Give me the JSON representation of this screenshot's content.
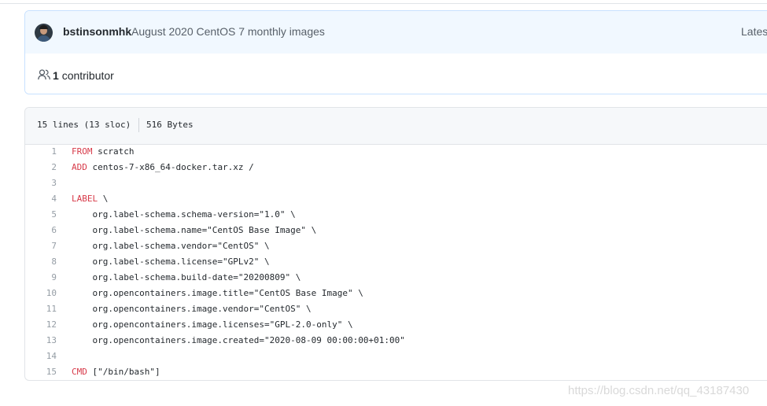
{
  "commit": {
    "author": "bstinsonmhk",
    "message": "August 2020 CentOS 7 monthly images",
    "latest_label": "Latest"
  },
  "contributors": {
    "count": "1",
    "label": "contributor"
  },
  "file": {
    "lines_info": "15 lines (13 sloc)",
    "size": "516 Bytes",
    "lines": [
      {
        "num": "1",
        "kw": "FROM",
        "rest": " scratch"
      },
      {
        "num": "2",
        "kw": "ADD",
        "rest": " centos-7-x86_64-docker.tar.xz /"
      },
      {
        "num": "3",
        "kw": "",
        "rest": ""
      },
      {
        "num": "4",
        "kw": "LABEL",
        "rest": " \\"
      },
      {
        "num": "5",
        "kw": "",
        "rest": "    org.label-schema.schema-version=\"1.0\" \\"
      },
      {
        "num": "6",
        "kw": "",
        "rest": "    org.label-schema.name=\"CentOS Base Image\" \\"
      },
      {
        "num": "7",
        "kw": "",
        "rest": "    org.label-schema.vendor=\"CentOS\" \\"
      },
      {
        "num": "8",
        "kw": "",
        "rest": "    org.label-schema.license=\"GPLv2\" \\"
      },
      {
        "num": "9",
        "kw": "",
        "rest": "    org.label-schema.build-date=\"20200809\" \\"
      },
      {
        "num": "10",
        "kw": "",
        "rest": "    org.opencontainers.image.title=\"CentOS Base Image\" \\"
      },
      {
        "num": "11",
        "kw": "",
        "rest": "    org.opencontainers.image.vendor=\"CentOS\" \\"
      },
      {
        "num": "12",
        "kw": "",
        "rest": "    org.opencontainers.image.licenses=\"GPL-2.0-only\" \\"
      },
      {
        "num": "13",
        "kw": "",
        "rest": "    org.opencontainers.image.created=\"2020-08-09 00:00:00+01:00\""
      },
      {
        "num": "14",
        "kw": "",
        "rest": ""
      },
      {
        "num": "15",
        "kw": "CMD",
        "rest": " [\"/bin/bash\"]"
      }
    ]
  },
  "watermark": "https://blog.csdn.net/qq_43187430",
  "colors": {
    "keyword": "#d73a49",
    "line_number": "#959da5",
    "commit_bg": "#f1f8ff"
  }
}
